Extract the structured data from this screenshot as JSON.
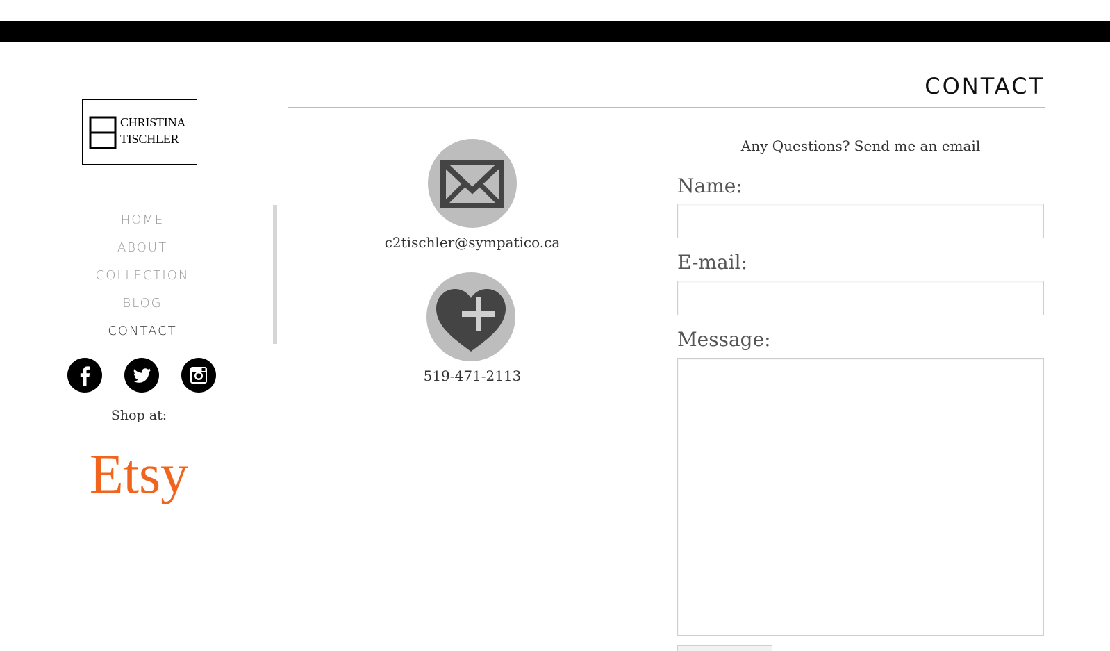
{
  "logo": {
    "line1": "CHRISTINA",
    "line2": "TISCHLER"
  },
  "nav": {
    "items": [
      {
        "label": "HOME"
      },
      {
        "label": "ABOUT"
      },
      {
        "label": "COLLECTION"
      },
      {
        "label": "BLOG"
      },
      {
        "label": "CONTACT"
      }
    ],
    "active": "CONTACT"
  },
  "social": {
    "icons": [
      "facebook-icon",
      "twitter-icon",
      "instagram-icon"
    ]
  },
  "shop": {
    "label": "Shop at:",
    "store": "Etsy",
    "store_color": "#f1641e"
  },
  "page": {
    "title": "CONTACT"
  },
  "contact": {
    "email": "c2tischler@sympatico.ca",
    "phone": "519-471-2113",
    "email_icon": "envelope-icon",
    "phone_icon": "heart-plus-icon"
  },
  "form": {
    "intro": "Any Questions? Send me an email",
    "name_label": "Name:",
    "email_label": "E-mail:",
    "message_label": "Message:",
    "name_value": "",
    "email_value": "",
    "message_value": ""
  },
  "colors": {
    "topbar": "#000000",
    "icon_circle": "#bdbdbd",
    "icon_glyph": "#444444",
    "etsy": "#f1641e"
  }
}
